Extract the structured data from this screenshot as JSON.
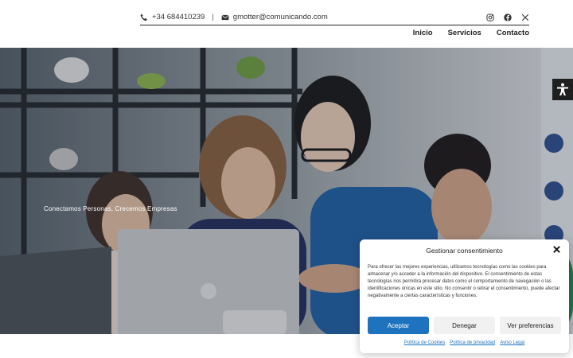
{
  "header": {
    "phone": "+34 684410239",
    "separator": "|",
    "email": "gmotter@comunicando.com",
    "socials": [
      "instagram-icon",
      "facebook-icon",
      "x-icon"
    ]
  },
  "nav": {
    "items": [
      "Inicio",
      "Servicios",
      "Contacto"
    ]
  },
  "hero": {
    "tagline": "Conectamos Personas, Crecemos Empresas"
  },
  "cookie_banner": {
    "title": "Gestionar consentimiento",
    "body": "Para ofrecer las mejores experiencias, utilizamos tecnologías como las cookies para almacenar y/o acceder a la información del dispositivo. El consentimiento de estas tecnologías nos permitirá procesar datos como el comportamiento de navegación o las identificaciones únicas en este sitio. No consentir o retirar el consentimiento, puede afectar negativamente a ciertas características y funciones.",
    "accept_label": "Aceptar",
    "deny_label": "Denegar",
    "prefs_label": "Ver preferencias",
    "links": [
      "Política de Cookies",
      "Política de privacidad",
      "Aviso Legal"
    ]
  },
  "colors": {
    "accent": "#1e73be",
    "accessibility_button": "#1f1f1f"
  }
}
